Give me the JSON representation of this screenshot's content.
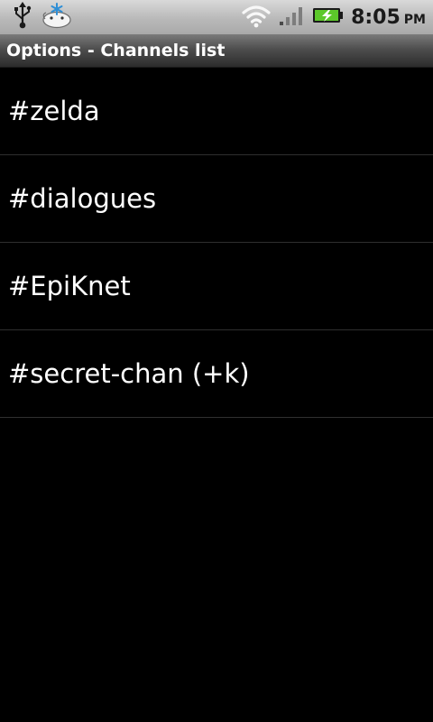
{
  "status_bar": {
    "time": "8:05",
    "ampm": "PM",
    "icons": [
      "usb-icon",
      "debug-android-icon",
      "wifi-icon",
      "signal-icon",
      "battery-charging-icon"
    ]
  },
  "title_bar": {
    "title": "Options - Channels list"
  },
  "channels": [
    {
      "label": "#zelda"
    },
    {
      "label": "#dialogues"
    },
    {
      "label": "#EpiKnet"
    },
    {
      "label": "#secret-chan (+k)"
    }
  ],
  "colors": {
    "background": "#000000",
    "battery_green": "#5cc82a",
    "divider": "#2f2f2f"
  }
}
